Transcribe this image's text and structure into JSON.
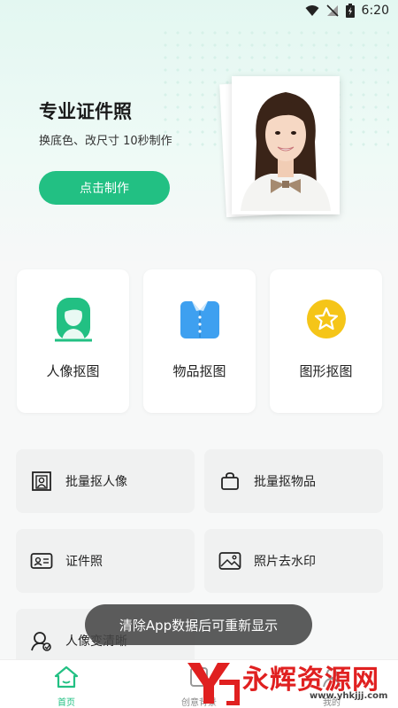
{
  "status_bar": {
    "time": "6:20"
  },
  "hero": {
    "title": "专业证件照",
    "subtitle": "换底色、改尺寸 10秒制作",
    "button_label": "点击制作"
  },
  "features": [
    {
      "label": "人像抠图",
      "icon": "portrait-person-icon"
    },
    {
      "label": "物品抠图",
      "icon": "shirt-icon"
    },
    {
      "label": "图形抠图",
      "icon": "star-badge-icon"
    }
  ],
  "tools": [
    {
      "label": "批量抠人像",
      "icon": "portrait-frame-icon"
    },
    {
      "label": "批量抠物品",
      "icon": "bag-icon"
    },
    {
      "label": "证件照",
      "icon": "id-card-icon"
    },
    {
      "label": "照片去水印",
      "icon": "image-icon"
    },
    {
      "label": "人像变清晰",
      "icon": "face-enhance-icon"
    }
  ],
  "toast": {
    "message": "清除App数据后可重新显示"
  },
  "bottom_nav": [
    {
      "label": "首页",
      "active": true
    },
    {
      "label": "创意背景",
      "active": false
    },
    {
      "label": "我的",
      "active": false
    }
  ],
  "watermark": {
    "text": "永辉资源网",
    "url": "www.yhkjjj.com"
  },
  "colors": {
    "accent": "#22c083",
    "star": "#f5c518",
    "shirt": "#3ea0f0"
  }
}
